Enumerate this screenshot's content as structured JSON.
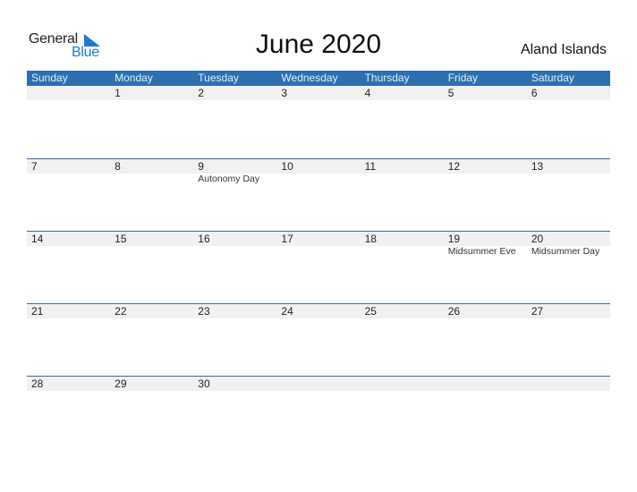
{
  "logo": {
    "word1": "General",
    "word2": "Blue"
  },
  "title": "June 2020",
  "country": "Aland Islands",
  "colors": {
    "header_bg": "#2e6fb0",
    "row_bg": "#f1f1f1",
    "brand": "#1f7ac9"
  },
  "weekdays": [
    "Sunday",
    "Monday",
    "Tuesday",
    "Wednesday",
    "Thursday",
    "Friday",
    "Saturday"
  ],
  "weeks": [
    {
      "dates": [
        "",
        "1",
        "2",
        "3",
        "4",
        "5",
        "6"
      ],
      "events": [
        "",
        "",
        "",
        "",
        "",
        "",
        ""
      ]
    },
    {
      "dates": [
        "7",
        "8",
        "9",
        "10",
        "11",
        "12",
        "13"
      ],
      "events": [
        "",
        "",
        "Autonomy Day",
        "",
        "",
        "",
        ""
      ]
    },
    {
      "dates": [
        "14",
        "15",
        "16",
        "17",
        "18",
        "19",
        "20"
      ],
      "events": [
        "",
        "",
        "",
        "",
        "",
        "Midsummer Eve",
        "Midsummer Day"
      ]
    },
    {
      "dates": [
        "21",
        "22",
        "23",
        "24",
        "25",
        "26",
        "27"
      ],
      "events": [
        "",
        "",
        "",
        "",
        "",
        "",
        ""
      ]
    },
    {
      "dates": [
        "28",
        "29",
        "30",
        "",
        "",
        "",
        ""
      ],
      "events": [
        "",
        "",
        "",
        "",
        "",
        "",
        ""
      ]
    }
  ]
}
